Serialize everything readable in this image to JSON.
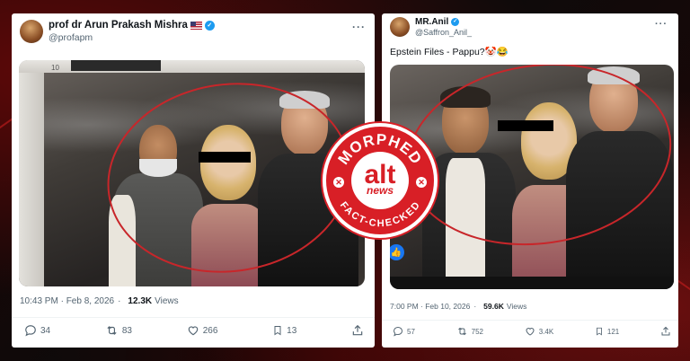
{
  "left_post": {
    "author_name": "prof dr Arun Prakash Mishra",
    "author_handle": "@profapm",
    "image_frame_number": "10",
    "timestamp": "10:43 PM · Feb 8, 2026",
    "views_count": "12.3K",
    "views_label": "Views",
    "replies": "34",
    "reposts": "83",
    "likes": "266",
    "bookmarks": "13",
    "icons": [
      "flag-icon",
      "verified-icon",
      "more-icon",
      "reply-icon",
      "repost-icon",
      "like-icon",
      "bookmark-icon",
      "share-icon"
    ]
  },
  "right_post": {
    "author_name": "MR.Anil",
    "author_handle": "@Saffron_Anil_",
    "text": "Epstein Files - Pappu?🤡😂",
    "timestamp": "7:00 PM · Feb 10, 2026",
    "views_count": "59.6K",
    "views_label": "Views",
    "replies": "57",
    "reposts": "752",
    "likes": "3.4K",
    "bookmarks": "121",
    "icons": [
      "verified-icon",
      "more-icon",
      "thumbs-up-icon",
      "reply-icon",
      "repost-icon",
      "like-icon",
      "bookmark-icon",
      "share-icon"
    ]
  },
  "badge": {
    "top_text": "MORPHED",
    "bottom_text": "FACT-CHECKED",
    "logo_main": "alt",
    "logo_sub": "news"
  },
  "colors": {
    "accent_red": "#d81f26",
    "verified_blue": "#1d9bf0",
    "muted_text": "#536471",
    "background": "#141010"
  }
}
